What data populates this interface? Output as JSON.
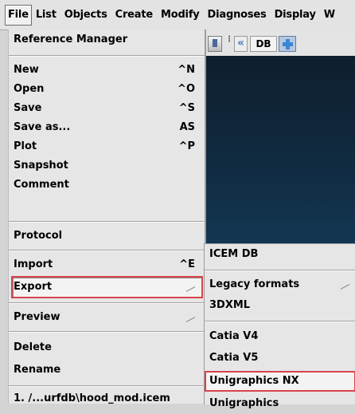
{
  "menubar": [
    "File",
    "List",
    "Objects",
    "Create",
    "Modify",
    "Diagnoses",
    "Display",
    "W"
  ],
  "toolbar": {
    "db_label": "DB"
  },
  "file_menu": {
    "reference_manager": "Reference Manager",
    "items": [
      {
        "label": "New",
        "shortcut": "^N"
      },
      {
        "label": "Open",
        "shortcut": "^O"
      },
      {
        "label": "Save",
        "shortcut": "^S"
      },
      {
        "label": "Save as...",
        "shortcut": "AS"
      },
      {
        "label": "Plot",
        "shortcut": "^P"
      },
      {
        "label": "Snapshot",
        "shortcut": ""
      },
      {
        "label": "Comment",
        "shortcut": ""
      }
    ],
    "protocol": "Protocol",
    "import": {
      "label": "Import",
      "shortcut": "^E"
    },
    "export": "Export",
    "preview": "Preview",
    "delete": "Delete",
    "rename": "Rename",
    "recent": "1. /...urfdb\\hood_mod.icem"
  },
  "export_submenu": {
    "icem_db": "ICEM DB",
    "legacy_formats": "Legacy formats",
    "threedxml": "3DXML",
    "catia_v4": "Catia V4",
    "catia_v5": "Catia V5",
    "unigraphics_nx": "Unigraphics NX",
    "unigraphics": "Unigraphics"
  },
  "colors": {
    "highlight_border": "#d8444a",
    "viewport": "#102a40"
  }
}
